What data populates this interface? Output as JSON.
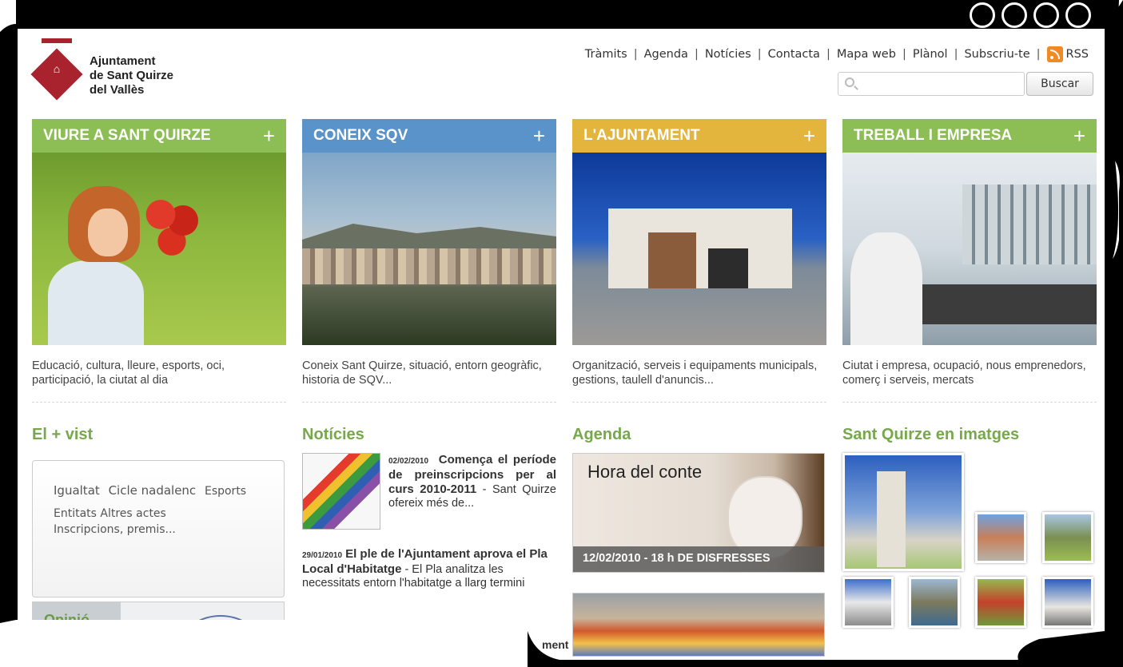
{
  "header": {
    "logo_lines": [
      "Ajuntament",
      "de Sant Quirze",
      "del Vallès"
    ],
    "nav": [
      "Tràmits",
      "Agenda",
      "Notícies",
      "Contacta",
      "Mapa web",
      "Plànol",
      "Subscriu-te"
    ],
    "rss_label": "RSS",
    "search_placeholder": "",
    "search_button": "Buscar"
  },
  "columns": [
    {
      "title": "VIURE A SANT QUIRZE",
      "plus": "+",
      "color": "#8dbe55",
      "desc": "Educació, cultura, lleure, esports, oci, participació, la ciutat al dia"
    },
    {
      "title": "CONEIX SQV",
      "plus": "+",
      "color": "#5a93c9",
      "desc": "Coneix Sant Quirze, situació, entorn geogràfic, historia de SQV..."
    },
    {
      "title": "L'AJUNTAMENT",
      "plus": "+",
      "color": "#e3b53d",
      "desc": "Organització, serveis i equipaments municipals, gestions, taulell d'anuncis..."
    },
    {
      "title": "TREBALL I EMPRESA",
      "plus": "+",
      "color": "#8dbe55",
      "desc": "Ciutat i empresa, ocupació, nous emprenedors, comerç i serveis, mercats"
    }
  ],
  "mes_vist": {
    "title": "El + vist",
    "tags_row1": [
      "Igualtat",
      "Cicle nadalenc",
      "Esports"
    ],
    "tags_row2": [
      "Entitats",
      "Altres actes",
      "Inscripcions, premis..."
    ],
    "opinio": "Opinió"
  },
  "noticies": {
    "title": "Notícies",
    "items": [
      {
        "date": "02/02/2010",
        "title": "Comença el període de preinscripcions per al curs 2010-2011",
        "text": " - Sant Quirze ofereix més de..."
      },
      {
        "date": "29/01/2010",
        "title": "El ple de l'Ajuntament aprova el Pla Local d'Habitatge",
        "text": " - El Pla analitza les necessitats entorn l'habitatge a llarg termini"
      }
    ],
    "partial": "ment"
  },
  "agenda": {
    "title": "Agenda",
    "item1_title": "Hora del conte",
    "item1_bar": "12/02/2010 - 18 h DE DISFRESSES"
  },
  "imatges": {
    "title": "Sant Quirze en imatges"
  }
}
